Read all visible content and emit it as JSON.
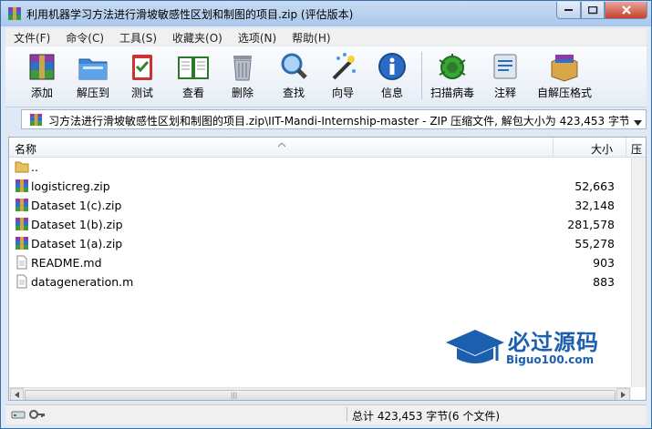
{
  "window": {
    "title": "利用机器学习方法进行滑坡敏感性区划和制图的项目.zip (评估版本)"
  },
  "menu": [
    "文件(F)",
    "命令(C)",
    "工具(S)",
    "收藏夹(O)",
    "选项(N)",
    "帮助(H)"
  ],
  "toolbar": {
    "add": "添加",
    "extract": "解压到",
    "test": "测试",
    "view": "查看",
    "delete": "删除",
    "find": "查找",
    "wizard": "向导",
    "info": "信息",
    "scan": "扫描病毒",
    "comment": "注释",
    "sfx": "自解压格式"
  },
  "address": {
    "path": "习方法进行滑坡敏感性区划和制图的项目.zip\\IIT-Mandi-Internship-master - ZIP 压缩文件, 解包大小为 423,453 字节"
  },
  "columns": {
    "name": "名称",
    "size": "大小",
    "extra": "压"
  },
  "files": [
    {
      "name": "..",
      "size": "",
      "icon": "folder-icon"
    },
    {
      "name": "logisticreg.zip",
      "size": "52,663",
      "icon": "archive-icon"
    },
    {
      "name": "Dataset 1(c).zip",
      "size": "32,148",
      "icon": "archive-icon"
    },
    {
      "name": "Dataset 1(b).zip",
      "size": "281,578",
      "icon": "archive-icon"
    },
    {
      "name": "Dataset 1(a).zip",
      "size": "55,278",
      "icon": "archive-icon"
    },
    {
      "name": "README.md",
      "size": "903",
      "icon": "document-icon"
    },
    {
      "name": "datageneration.m",
      "size": "883",
      "icon": "document-icon"
    }
  ],
  "status": {
    "total": "总计 423,453 字节(6 个文件)"
  },
  "watermark": {
    "title": "必过源码",
    "sub": "Biguo100.com"
  }
}
